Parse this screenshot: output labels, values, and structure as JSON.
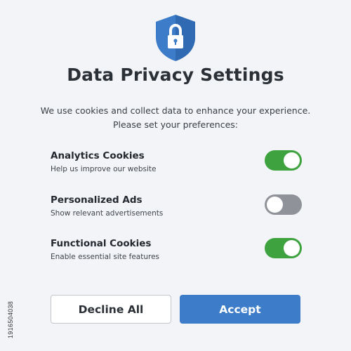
{
  "dialog": {
    "title": "Data Privacy Settings",
    "intro_line1": "We use cookies and collect data to enhance your experience.",
    "intro_line2": "Please set your preferences:",
    "shield_icon": "lock-shield-icon",
    "accent_color": "#3d7cc9"
  },
  "settings": [
    {
      "title": "Analytics Cookies",
      "description": "Help us improve our website",
      "enabled": true
    },
    {
      "title": "Personalized Ads",
      "description": "Show relevant advertisements",
      "enabled": false
    },
    {
      "title": "Functional Cookies",
      "description": "Enable essential site features",
      "enabled": true
    }
  ],
  "buttons": {
    "decline_label": "Decline All",
    "accept_label": "Accept"
  },
  "stock_id": "1916504038",
  "colors": {
    "toggle_on": "#3ea33e",
    "toggle_off": "#8f9298",
    "accept": "#3d7cc9"
  }
}
